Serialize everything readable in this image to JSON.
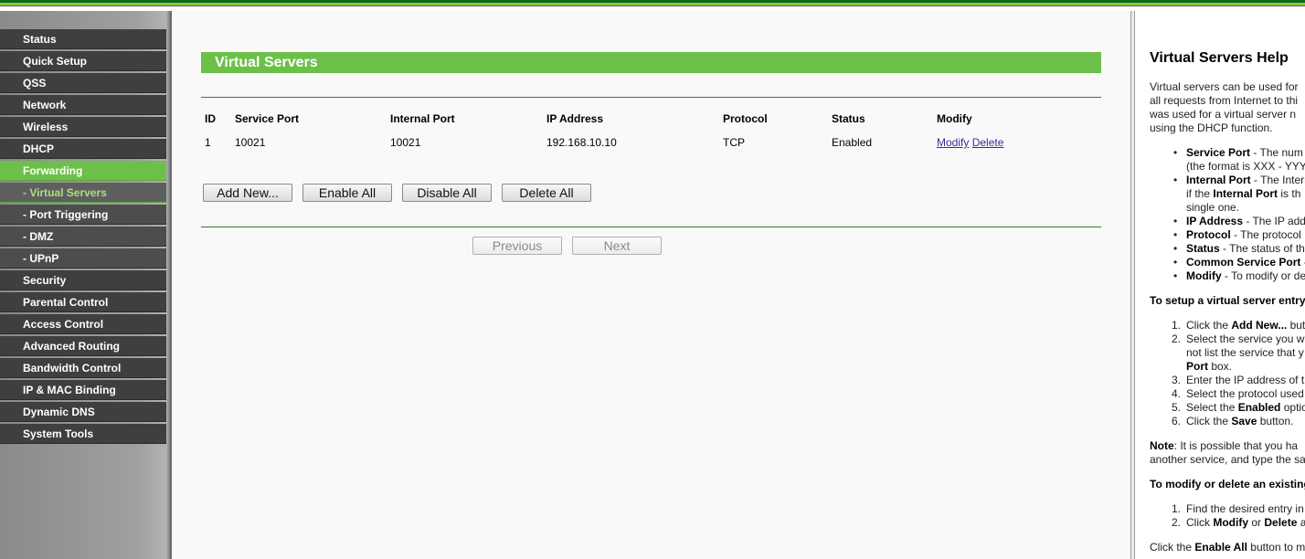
{
  "sidebar": {
    "items": [
      {
        "label": "Status"
      },
      {
        "label": "Quick Setup"
      },
      {
        "label": "QSS"
      },
      {
        "label": "Network"
      },
      {
        "label": "Wireless"
      },
      {
        "label": "DHCP"
      },
      {
        "label": "Forwarding"
      },
      {
        "label": "- Virtual Servers"
      },
      {
        "label": "- Port Triggering"
      },
      {
        "label": "- DMZ"
      },
      {
        "label": "- UPnP"
      },
      {
        "label": "Security"
      },
      {
        "label": "Parental Control"
      },
      {
        "label": "Access Control"
      },
      {
        "label": "Advanced Routing"
      },
      {
        "label": "Bandwidth Control"
      },
      {
        "label": "IP & MAC Binding"
      },
      {
        "label": "Dynamic DNS"
      },
      {
        "label": "System Tools"
      }
    ]
  },
  "main": {
    "title": "Virtual Servers",
    "table": {
      "headers": [
        "ID",
        "Service Port",
        "Internal Port",
        "IP Address",
        "Protocol",
        "Status",
        "Modify"
      ],
      "rows": [
        {
          "id": "1",
          "service_port": "10021",
          "internal_port": "10021",
          "ip": "192.168.10.10",
          "protocol": "TCP",
          "status": "Enabled",
          "modify": "Modify",
          "delete": "Delete"
        }
      ]
    },
    "buttons": {
      "add_new": "Add New...",
      "enable_all": "Enable All",
      "disable_all": "Disable All",
      "delete_all": "Delete All",
      "previous": "Previous",
      "next": "Next"
    }
  },
  "help": {
    "title": "Virtual Servers Help",
    "intro": [
      "Virtual servers can be used for",
      "all requests from Internet to thi",
      "was used for a virtual server n",
      "using the DHCP function."
    ],
    "fields": [
      {
        "term": "Service Port",
        "text": " - The num"
      },
      {
        "term": "",
        "text": "(the format is XXX - YYY,"
      },
      {
        "term": "Internal Port",
        "text": " - The Interr"
      },
      {
        "term": "",
        "text": "if the ",
        "term2": "Internal Port",
        "text2": " is th"
      },
      {
        "term": "",
        "text": "single one."
      },
      {
        "term": "IP Address",
        "text": " - The IP add"
      },
      {
        "term": "Protocol",
        "text": " - The protocol"
      },
      {
        "term": "Status",
        "text": " - The status of th"
      },
      {
        "term": "Common Service Port",
        "text": " -"
      },
      {
        "term": "Modify",
        "text": " - To modify or de"
      }
    ],
    "setup_heading": "To setup a virtual server entry",
    "steps": [
      {
        "num": "1.",
        "pre": "Click the ",
        "bold": "Add New...",
        "post": " but"
      },
      {
        "num": "2.",
        "pre": "Select the service you w",
        "bold": "",
        "post": ""
      },
      {
        "num": "",
        "pre": "not list the service that y",
        "bold": "",
        "post": ""
      },
      {
        "num": "",
        "pre": "",
        "bold": "Port",
        "post": " box."
      },
      {
        "num": "3.",
        "pre": "Enter the IP address of t",
        "bold": "",
        "post": ""
      },
      {
        "num": "4.",
        "pre": "Select the protocol used",
        "bold": "",
        "post": ""
      },
      {
        "num": "5.",
        "pre": "Select the ",
        "bold": "Enabled",
        "post": " optio"
      },
      {
        "num": "6.",
        "pre": "Click the ",
        "bold": "Save",
        "post": " button."
      }
    ],
    "note_label": "Note",
    "note_lines": [
      ": It is possible that you ha",
      "another service, and type the sa"
    ],
    "modify_heading": "To modify or delete an existing",
    "modify_steps": [
      {
        "num": "1.",
        "pre": "Find the desired entry in",
        "bold": "",
        "mid": "",
        "bold2": "",
        "post": ""
      },
      {
        "num": "2.",
        "pre": "Click ",
        "bold": "Modify",
        "mid": " or ",
        "bold2": "Delete",
        "post": " a"
      }
    ],
    "footer": {
      "pre": "Click the ",
      "bold": "Enable All",
      "post": " button to m"
    }
  }
}
